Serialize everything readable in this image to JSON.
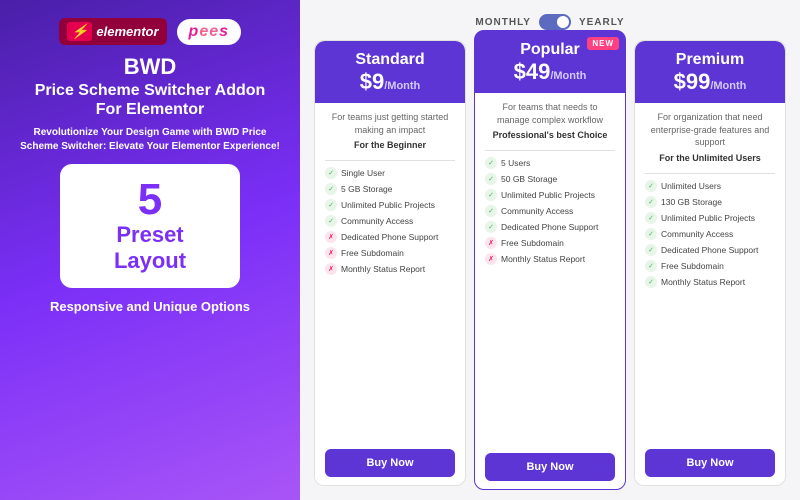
{
  "left": {
    "elementor_label": "elementor",
    "pss_label": "pss",
    "bwd_title": "BWD",
    "addon_title": "Price Scheme Switcher Addon For Elementor",
    "tagline": "Revolutionize Your Design Game with BWD Price Scheme Switcher: Elevate Your Elementor Experience!",
    "preset_number": "5",
    "preset_line1": "Preset",
    "preset_line2": "Layout",
    "responsive_text": "Responsive and Unique Options"
  },
  "billing": {
    "monthly_label": "MONTHLY",
    "yearly_label": "YEARLY"
  },
  "plans": [
    {
      "name": "Standard",
      "price_amount": "$9",
      "price_period": "/Month",
      "description": "For teams just getting started making an impact",
      "subtitle": "For the Beginner",
      "popular": false,
      "new_badge": false,
      "features": [
        {
          "text": "Single User",
          "type": "check"
        },
        {
          "text": "5 GB Storage",
          "type": "check"
        },
        {
          "text": "Unlimited Public Projects",
          "type": "check"
        },
        {
          "text": "Community Access",
          "type": "check"
        },
        {
          "text": "Dedicated Phone Support",
          "type": "cross"
        },
        {
          "text": "Free Subdomain",
          "type": "cross"
        },
        {
          "text": "Monthly Status Report",
          "type": "cross"
        }
      ],
      "button_label": "Buy Now"
    },
    {
      "name": "Popular",
      "price_amount": "$49",
      "price_period": "/Month",
      "description": "For teams that needs to manage complex workflow",
      "subtitle": "Professional's best Choice",
      "popular": true,
      "new_badge": true,
      "features": [
        {
          "text": "5 Users",
          "type": "check"
        },
        {
          "text": "50 GB Storage",
          "type": "check"
        },
        {
          "text": "Unlimited Public Projects",
          "type": "check"
        },
        {
          "text": "Community Access",
          "type": "check"
        },
        {
          "text": "Dedicated Phone Support",
          "type": "check"
        },
        {
          "text": "Free Subdomain",
          "type": "cross"
        },
        {
          "text": "Monthly Status Report",
          "type": "cross"
        }
      ],
      "button_label": "Buy Now"
    },
    {
      "name": "Premium",
      "price_amount": "$99",
      "price_period": "/Month",
      "description": "For organization that need enterprise-grade features and support",
      "subtitle": "For the Unlimited Users",
      "popular": false,
      "new_badge": false,
      "features": [
        {
          "text": "Unlimited Users",
          "type": "check"
        },
        {
          "text": "130 GB Storage",
          "type": "check"
        },
        {
          "text": "Unlimited Public Projects",
          "type": "check"
        },
        {
          "text": "Community Access",
          "type": "check"
        },
        {
          "text": "Dedicated Phone Support",
          "type": "check"
        },
        {
          "text": "Free Subdomain",
          "type": "check"
        },
        {
          "text": "Monthly Status Report",
          "type": "check"
        }
      ],
      "button_label": "Buy Now"
    }
  ]
}
